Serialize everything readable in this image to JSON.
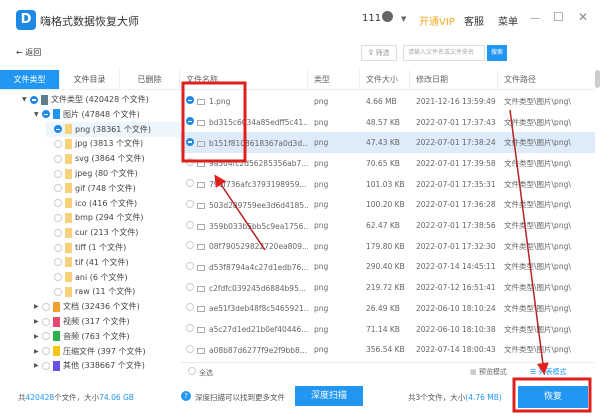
{
  "app": {
    "logo": "D",
    "title": "嗨格式数据恢复大师",
    "user": "111",
    "vip": "开通VIP",
    "service": "客服",
    "menu": "菜单",
    "minimize": "—",
    "maximize": "☐",
    "close": "✕"
  },
  "toolbar": {
    "back": "← 返回",
    "filter": "筛选",
    "search_placeholder": "请输入文件名或文件夹名",
    "search_btn": "搜索"
  },
  "tabs": [
    "文件类型",
    "文件目录",
    "已删除"
  ],
  "tree": [
    {
      "label": "文件类型 (420428 个文件)",
      "level": 0,
      "state": "on",
      "arrow": "▼",
      "color": "#607d8b"
    },
    {
      "label": "图片 (47848 个文件)",
      "level": 1,
      "state": "on",
      "arrow": "▼",
      "color": "#2196f3"
    },
    {
      "label": "png (38361 个文件)",
      "level": 2,
      "state": "on",
      "color": "#f7d27a",
      "sel": true
    },
    {
      "label": "jpg (3813 个文件)",
      "level": 2,
      "color": "#f7d27a"
    },
    {
      "label": "svg (3864 个文件)",
      "level": 2,
      "color": "#f7d27a"
    },
    {
      "label": "jpeg (80 个文件)",
      "level": 2,
      "color": "#f7d27a"
    },
    {
      "label": "gif (748 个文件)",
      "level": 2,
      "color": "#f7d27a"
    },
    {
      "label": "ico (416 个文件)",
      "level": 2,
      "color": "#f7d27a"
    },
    {
      "label": "bmp (294 个文件)",
      "level": 2,
      "color": "#f7d27a"
    },
    {
      "label": "cur (213 个文件)",
      "level": 2,
      "color": "#f7d27a"
    },
    {
      "label": "tiff (1 个文件)",
      "level": 2,
      "color": "#f7d27a"
    },
    {
      "label": "tif (41 个文件)",
      "level": 2,
      "color": "#f7d27a"
    },
    {
      "label": "ani (6 个文件)",
      "level": 2,
      "color": "#f7d27a"
    },
    {
      "label": "raw (11 个文件)",
      "level": 2,
      "color": "#f7d27a"
    },
    {
      "label": "文档 (32436 个文件)",
      "level": 1,
      "arrow": "▶",
      "color": "#f0a030"
    },
    {
      "label": "视频 (317 个文件)",
      "level": 1,
      "arrow": "▶",
      "color": "#e84a6f"
    },
    {
      "label": "音频 (763 个文件)",
      "level": 1,
      "arrow": "▶",
      "color": "#2bb24c"
    },
    {
      "label": "压缩文件 (397 个文件)",
      "level": 1,
      "arrow": "▶",
      "color": "#f5c518"
    },
    {
      "label": "其他 (338667 个文件)",
      "level": 1,
      "arrow": "▶",
      "color": "#6a4ee8"
    }
  ],
  "columns": [
    "文件名称",
    "类型",
    "文件大小",
    "修改日期",
    "文件路径"
  ],
  "files": [
    {
      "name": "1.png",
      "type": "png",
      "size": "4.66 MB",
      "date": "2021-12-16 13:59:49",
      "path": "文件类型\\图片\\png\\",
      "checked": true
    },
    {
      "name": "bd315c6034a85edff5c41...",
      "type": "png",
      "size": "48.57 KB",
      "date": "2022-07-01 17:37:43",
      "path": "文件类型\\图片\\png\\",
      "checked": true
    },
    {
      "name": "b151f8108618367a0d3d...",
      "type": "png",
      "size": "47.43 KB",
      "date": "2022-07-01 17:38:24",
      "path": "文件类型\\图片\\png\\",
      "checked": true,
      "highlight": true
    },
    {
      "name": "9a504fc2d56285356ab7...",
      "type": "png",
      "size": "70.65 KB",
      "date": "2022-07-01 17:39:58",
      "path": "文件类型\\图片\\png\\"
    },
    {
      "name": "790f736afc3793198959...",
      "type": "png",
      "size": "101.03 KB",
      "date": "2022-07-01 17:35:31",
      "path": "文件类型\\图片\\png\\"
    },
    {
      "name": "503d289759ee3d6d4185...",
      "type": "png",
      "size": "100.20 KB",
      "date": "2022-07-01 17:36:28",
      "path": "文件类型\\图片\\png\\"
    },
    {
      "name": "359b033b5bb5c9ea1756...",
      "type": "png",
      "size": "62.47 KB",
      "date": "2022-07-01 17:38:56",
      "path": "文件类型\\图片\\png\\"
    },
    {
      "name": "08f790529822720ea809...",
      "type": "png",
      "size": "179.80 KB",
      "date": "2022-07-01 17:32:30",
      "path": "文件类型\\图片\\png\\"
    },
    {
      "name": "d53f8794a4c27d1edb76...",
      "type": "png",
      "size": "290.40 KB",
      "date": "2022-07-14 14:45:11",
      "path": "文件类型\\图片\\png\\"
    },
    {
      "name": "c2fdfc039245d6884b95...",
      "type": "png",
      "size": "219.72 KB",
      "date": "2022-07-12 16:51:41",
      "path": "文件类型\\图片\\png\\"
    },
    {
      "name": "ae51f3deb48f8c5465921...",
      "type": "png",
      "size": "26.49 KB",
      "date": "2022-06-10 18:10:24",
      "path": "文件类型\\图片\\png\\"
    },
    {
      "name": "a5c27d1ed21b0ef40446...",
      "type": "png",
      "size": "71.14 KB",
      "date": "2022-06-10 18:10:38",
      "path": "文件类型\\图片\\png\\"
    },
    {
      "name": "a08b87d6277f9e2f9bb8...",
      "type": "png",
      "size": "356.54 KB",
      "date": "2022-07-14 18:00:43",
      "path": "文件类型\\图片\\png\\"
    }
  ],
  "footer": {
    "select_all": "全选",
    "preview_mode": "预览模式",
    "list_mode": "列表模式"
  },
  "bottom": {
    "total_prefix": "共",
    "total_count": "420428",
    "total_mid": "个文件，大小",
    "total_size": "74.06 GB",
    "deep_hint": "深度扫描可以找到更多文件",
    "deep_btn": "深度扫描",
    "selected_text": "共3个文件，大小",
    "selected_size": "(4.76 MB)",
    "recover_btn": "恢复"
  },
  "colors": {
    "accent": "#2196f3",
    "annotation": "#e0201c"
  }
}
